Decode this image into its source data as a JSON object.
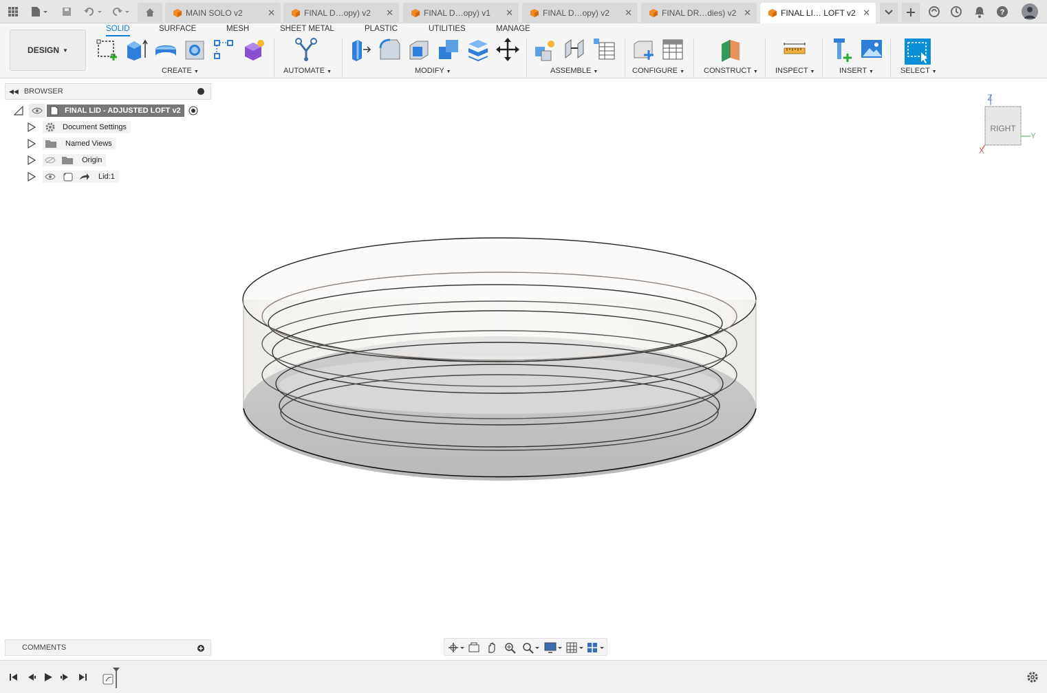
{
  "topbar": {
    "tabs": [
      {
        "label": "MAIN SOLO v2"
      },
      {
        "label": "FINAL D…opy) v2"
      },
      {
        "label": "FINAL D…opy) v1"
      },
      {
        "label": "FINAL D…opy) v2"
      },
      {
        "label": "FINAL DR…dies) v2"
      },
      {
        "label": "FINAL LI… LOFT v2"
      }
    ],
    "close_glyph": "✕",
    "icons": [
      "grid-menu-icon",
      "file-icon",
      "save-icon",
      "undo-icon",
      "redo-icon",
      "home-icon",
      "tab-overflow-icon",
      "new-tab-icon",
      "online-status-icon",
      "job-status-icon",
      "notifications-icon",
      "help-icon",
      "user-avatar-icon"
    ]
  },
  "ribbon": {
    "design_label": "DESIGN",
    "workspace_tabs": [
      "SOLID",
      "SURFACE",
      "MESH",
      "SHEET METAL",
      "PLASTIC",
      "UTILITIES",
      "MANAGE"
    ],
    "groups": {
      "create": "CREATE",
      "automate": "AUTOMATE",
      "modify": "MODIFY",
      "assemble": "ASSEMBLE",
      "configure": "CONFIGURE",
      "construct": "CONSTRUCT",
      "inspect": "INSPECT",
      "insert": "INSERT",
      "select": "SELECT"
    },
    "accent": "#0a7dd6"
  },
  "browser": {
    "title": "BROWSER",
    "root": "FINAL LID - ADJUSTED LOFT v2",
    "items": [
      {
        "label": "Document Settings"
      },
      {
        "label": "Named Views"
      },
      {
        "label": "Origin"
      },
      {
        "label": "Lid:1"
      }
    ]
  },
  "viewcube": {
    "face": "RIGHT",
    "axis_z": "Z",
    "axis_y": "Y",
    "axis_x": "X"
  },
  "comments": {
    "title": "COMMENTS"
  }
}
